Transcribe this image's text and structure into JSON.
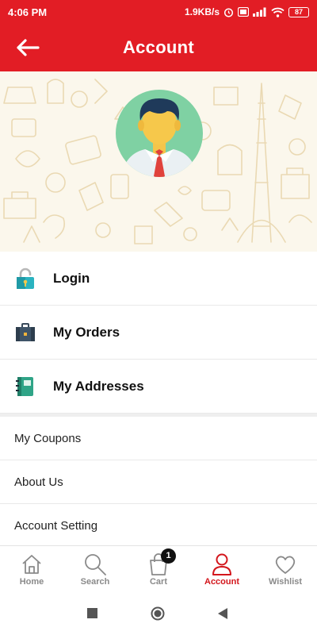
{
  "status_bar": {
    "time": "4:06 PM",
    "net_speed": "1.9KB/s",
    "battery": "87"
  },
  "app_bar": {
    "title": "Account",
    "back_icon": "arrow-left-icon"
  },
  "colors": {
    "brand_red": "#e21d25",
    "active_nav": "#d3161c",
    "inactive_nav": "#8a8a8a"
  },
  "profile": {
    "avatar_icon": "user-avatar-icon"
  },
  "menu": {
    "primary_items": [
      {
        "label": "Login",
        "icon": "lock-icon"
      },
      {
        "label": "My Orders",
        "icon": "briefcase-icon"
      },
      {
        "label": "My Addresses",
        "icon": "address-book-icon"
      }
    ],
    "secondary_items": [
      {
        "label": "My Coupons"
      },
      {
        "label": "About Us"
      },
      {
        "label": "Account Setting"
      }
    ]
  },
  "bottom_nav": {
    "items": [
      {
        "label": "Home",
        "icon": "home-icon",
        "active": false
      },
      {
        "label": "Search",
        "icon": "search-icon",
        "active": false
      },
      {
        "label": "Cart",
        "icon": "cart-bag-icon",
        "active": false,
        "badge": "1"
      },
      {
        "label": "Account",
        "icon": "person-icon",
        "active": true
      },
      {
        "label": "Wishlist",
        "icon": "heart-icon",
        "active": false
      }
    ]
  }
}
